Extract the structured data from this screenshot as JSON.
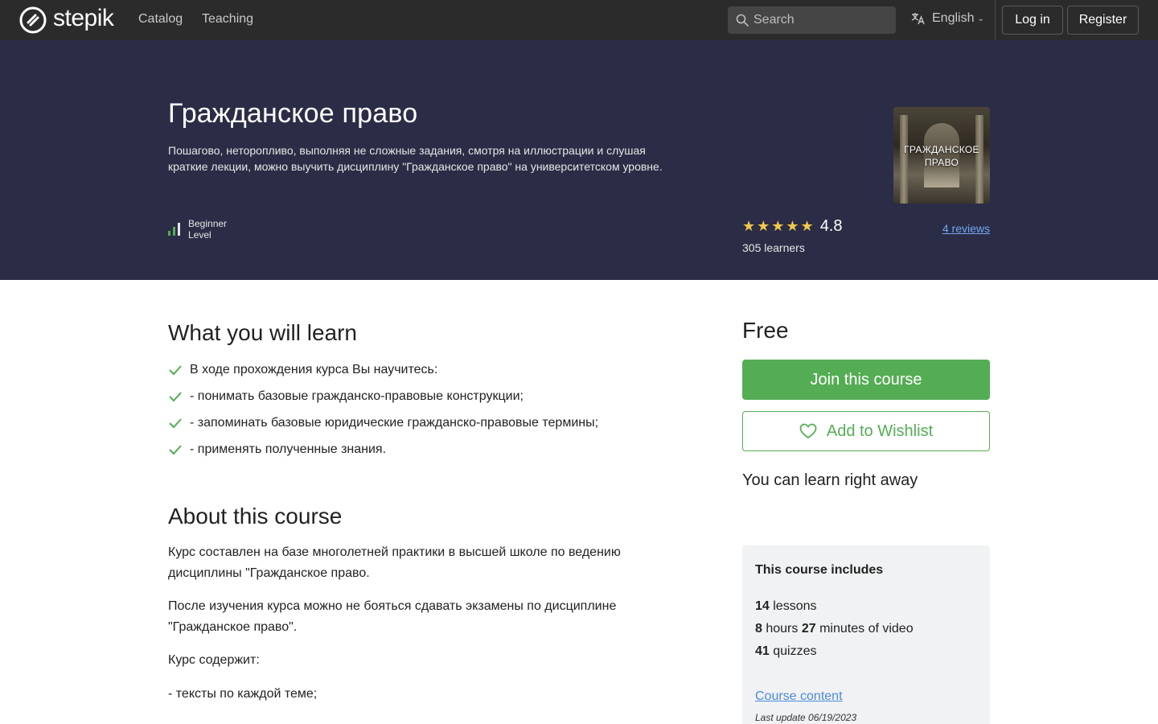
{
  "nav": {
    "logo_text": "stepik",
    "links": [
      "Catalog",
      "Teaching"
    ],
    "search_placeholder": "Search",
    "language": "English",
    "login": "Log in",
    "register": "Register"
  },
  "hero": {
    "title": "Гражданское право",
    "subtitle": "Пошагово, неторопливо, выполняя не сложные задания, смотря на иллюстрации и слушая краткие лекции, можно выучить дисциплину \"Гражданское право\" на университетском уровне.",
    "level_line1": "Beginner",
    "level_line2": "Level",
    "cover_text_line1": "ГРАЖДАНСКОЕ",
    "cover_text_line2": "ПРАВО",
    "stars": "★★★★★",
    "rating": "4.8",
    "reviews": "4 reviews",
    "learners": "305 learners"
  },
  "learn": {
    "title": "What you will learn",
    "items": [
      "В ходе прохождения курса Вы научитесь:",
      "- понимать базовые гражданско-правовые конструкции;",
      "- запоминать базовые юридические гражданско-правовые термины;",
      "- применять полученные знания."
    ]
  },
  "about": {
    "title": "About this course",
    "paragraphs": [
      "Курс составлен на базе многолетней практики в высшей школе по ведению дисциплины \"Гражданское право.",
      "После изучения курса можно не бояться сдавать экзамены по дисциплине \"Гражданское право\".",
      "Курс содержит:",
      "- тексты по каждой теме;"
    ]
  },
  "sidebar": {
    "price": "Free",
    "join_label": "Join this course",
    "wishlist_label": "Add to Wishlist",
    "learn_away": "You can learn right away",
    "includes_title": "This course includes",
    "lessons_num": "14",
    "lessons_label": "lessons",
    "hours_num": "8",
    "hours_label": "hours",
    "minutes_num": "27",
    "minutes_label": "minutes of video",
    "quizzes_num": "41",
    "quizzes_label": "quizzes",
    "course_content": "Course content",
    "last_update": "Last update 06/19/2023"
  },
  "colors": {
    "nav_bg": "#2b2b2b",
    "hero_bg": "#2b2d46",
    "accent_green": "#54ad54",
    "link_blue": "#4a8bd9",
    "star_yellow": "#f1c84b",
    "includes_bg": "#f1f2f4"
  }
}
